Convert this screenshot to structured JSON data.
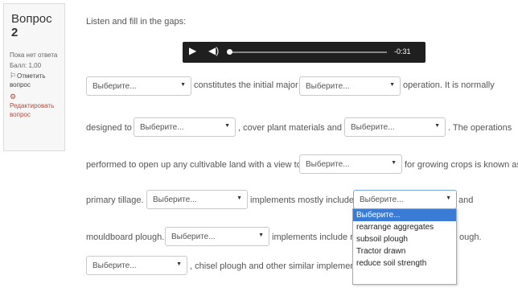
{
  "question_info": {
    "qno_prefix": "Вопрос",
    "qno_number": "2",
    "state": "Пока нет ответа",
    "grade": "Балл: 1,00",
    "flag_label": "Отметить вопрос",
    "edit_label": "Редактировать вопрос",
    "flag_icon": "flag-icon",
    "edit_icon": "gear-icon"
  },
  "prompt": "Listen and fill in the gaps:",
  "audio": {
    "time": "-0:31",
    "play_icon": "play-icon",
    "volume_icon": "volume-icon"
  },
  "select_placeholder": "Выберите...",
  "sentences": {
    "s1": "constitutes the initial major",
    "s2": "operation. It is normally",
    "s3": "designed to",
    "s4": ", cover plant materials and",
    "s5": ". The operations",
    "s6": "performed to open up any cultivable land with a view to",
    "s7": "for growing crops is known as",
    "s8": "primary tillage.",
    "s9": "implements mostly include",
    "s10": "and",
    "s11": "mouldboard plough.",
    "s12": "implements include m",
    "s13": "ough.",
    "s14": ", chisel plough and other similar implemen"
  },
  "dropdown_options": [
    "Выберите...",
    "rearrange aggregates",
    "subsoil plough",
    "Tractor drawn",
    "reduce soil strength"
  ]
}
